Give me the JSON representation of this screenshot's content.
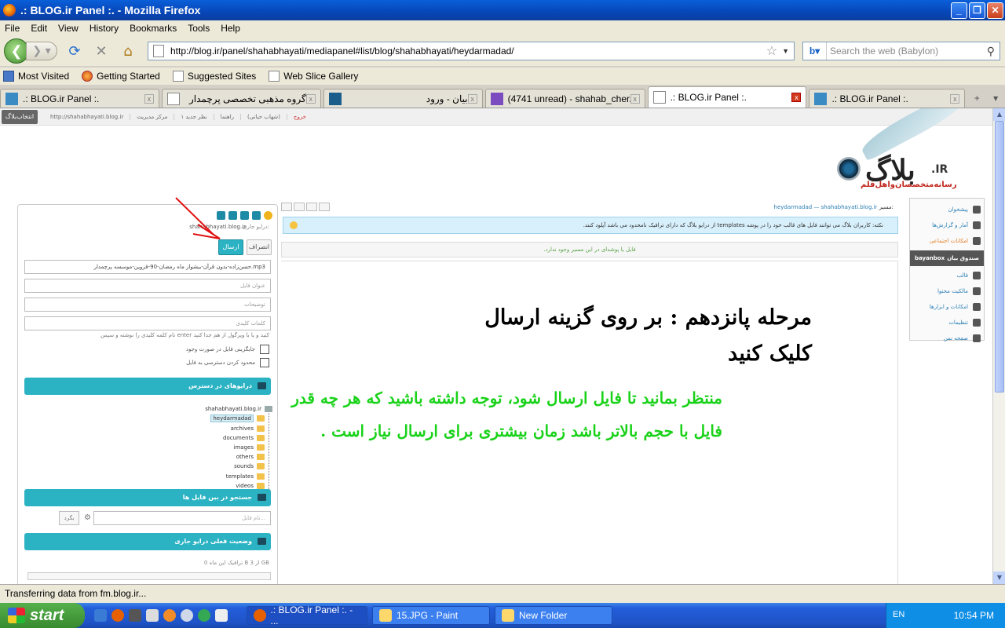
{
  "window": {
    "title": ".: BLOG.ir Panel :. - Mozilla Firefox",
    "minimize": "_",
    "maximize": "❐",
    "close": "✕"
  },
  "menu": [
    "File",
    "Edit",
    "View",
    "History",
    "Bookmarks",
    "Tools",
    "Help"
  ],
  "nav": {
    "url": "http://blog.ir/panel/shahabhayati/mediapanel#list/blog/shahabhayati/heydarmadad/",
    "search_placeholder": "Search the web (Babylon)"
  },
  "bookmarks": [
    "Most Visited",
    "Getting Started",
    "Suggested Sites",
    "Web Slice Gallery"
  ],
  "tabs": [
    {
      "label": ".: BLOG.ir Panel :.",
      "active": false
    },
    {
      "label": "گروه مذهبی تخصصی پرچمدار",
      "active": false
    },
    {
      "label": "بیان - ورود",
      "active": false
    },
    {
      "label": "(4741 unread) - shahab_cher...",
      "active": false
    },
    {
      "label": ".: BLOG.ir Panel :.",
      "active": true
    },
    {
      "label": ".: BLOG.ir Panel :.",
      "active": false
    }
  ],
  "blog": {
    "brand_button": "انتخاب‌بلاگ",
    "top_links": [
      "http://shahabhayati.blog.ir",
      "مرکز مدیریت",
      "۱ نظر جدید",
      "راهنما",
      "(شهاب حیاتی)"
    ],
    "logout": "خروج",
    "logo_word": "بلاگ",
    "logo_ir": ".IR",
    "logo_tagline": "رسانه‌متخصصان‌واهل‌قلم"
  },
  "upload": {
    "current_label": "درایو جاری:",
    "current_path": "shahabhayati.blog.ir",
    "send": "ارسال",
    "cancel": "انصراف",
    "file_value": "حسن‌زاده-بدون قرآن-بیشواز ماه رمضان-90-قزوین-موسسه پرچمدار.mp3",
    "title_placeholder": "عنوان فایل",
    "desc_placeholder": "توضیحات",
    "keywords_placeholder": "کلمات کلیدی",
    "keywords_hint": "نام کلمه کلیدی را نوشته و سپس enter کنید و یا با ویرگول از هم جدا کنید",
    "replace_label": "جایگزینی فایل در صورت وجود",
    "restrict_label": "محدود کردن دسترسی به فایل",
    "drives_title": "درایوهای در دسترس",
    "search_title": "جستجو در بین فایل ها",
    "search_placeholder": "نام فایل...",
    "search_btn": "بگرد",
    "status_title": "وضعیت فعلی درایو جاری",
    "quota": "ترافیک این ماه 0 B از 3 GB"
  },
  "tree": {
    "root": "shahabhayati.blog.ir",
    "selected": "heydarmadad",
    "folders": [
      "archives",
      "documents",
      "images",
      "others",
      "sounds",
      "templates",
      "videos"
    ]
  },
  "main": {
    "crumb_label": "مسیر:",
    "crumb_root": "shahabhayati.blog.ir",
    "crumb_sep": "—",
    "crumb_current": "heydarmadad",
    "notice": "نکته: کاربران بلاگ می توانند فایل های قالب خود را در پوشه templates از درایو بلاگ که دارای ترافیک نامحدود می باشد آپلود کنند.",
    "empty": "فایل یا پوشه‌ای در این مسیر وجود ندارد.",
    "step_title": "مرحله پانزدهم : بر روی گزینه ارسال کلیک کنید",
    "wait_note": "منتظر بمانید تا فایل ارسال شود، توجه داشته باشید که هر چه قدر فایل با حجم بالاتر باشد زمان بیشتری برای ارسال نیاز است ."
  },
  "rnav": [
    "پیشخوان",
    "آمار و گزارش‌ها",
    "امکانات اجتماعی",
    "صندوق بیان",
    "قالب",
    "مالکیت محتوا",
    "امکانات و ابزارها",
    "تنظیمات",
    "صفحه نمن"
  ],
  "rnav_box": "bayanbox",
  "status": "Transferring data from fm.blog.ir...",
  "taskbar": {
    "start": "start",
    "items": [
      ".: BLOG.ir Panel :. - ...",
      "15.JPG - Paint",
      "New Folder"
    ],
    "lang": "EN",
    "clock": "10:54 PM"
  },
  "colors": {
    "accent": "#2bb3c4",
    "instruction_green": "#19d219",
    "annotation_red": "#e01010"
  }
}
